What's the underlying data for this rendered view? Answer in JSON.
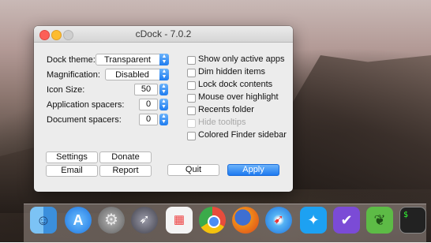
{
  "window": {
    "title": "cDock - 7.0.2"
  },
  "settings": {
    "dock_theme": {
      "label": "Dock theme:",
      "value": "Transparent"
    },
    "magnification": {
      "label": "Magnification:",
      "value": "Disabled"
    },
    "icon_size": {
      "label": "Icon Size:",
      "value": "50"
    },
    "app_spacers": {
      "label": "Application spacers:",
      "value": "0"
    },
    "doc_spacers": {
      "label": "Document spacers:",
      "value": "0"
    }
  },
  "options": [
    {
      "label": "Show only active apps",
      "checked": false,
      "disabled": false
    },
    {
      "label": "Dim hidden items",
      "checked": false,
      "disabled": false
    },
    {
      "label": "Lock dock contents",
      "checked": false,
      "disabled": false
    },
    {
      "label": "Mouse over highlight",
      "checked": false,
      "disabled": false
    },
    {
      "label": "Recents folder",
      "checked": false,
      "disabled": false
    },
    {
      "label": "Hide tooltips",
      "checked": false,
      "disabled": true
    },
    {
      "label": "Colored Finder sidebar",
      "checked": false,
      "disabled": false
    }
  ],
  "buttons": {
    "settings": "Settings",
    "donate": "Donate",
    "email": "Email",
    "report": "Report",
    "quit": "Quit",
    "apply": "Apply"
  },
  "dock": {
    "apps": [
      {
        "icon": "finder-icon",
        "color": "#4aa3e8"
      },
      {
        "icon": "app-store-icon",
        "color": "#2f8fe6"
      },
      {
        "icon": "system-preferences-icon",
        "color": "#8a8a8a"
      },
      {
        "icon": "launchpad-icon",
        "color": "#6c6c7a"
      },
      {
        "icon": "app-grid-icon",
        "color": "#f2f2f2"
      },
      {
        "icon": "chrome-icon",
        "color": "#e74c3c"
      },
      {
        "icon": "firefox-icon",
        "color": "#f07a1a"
      },
      {
        "icon": "safari-icon",
        "color": "#2a8fe8"
      },
      {
        "icon": "twitter-icon",
        "color": "#1da1f2"
      },
      {
        "icon": "omnifocus-icon",
        "color": "#7b4bd6"
      },
      {
        "icon": "evernote-icon",
        "color": "#5dbb46"
      },
      {
        "icon": "terminal-icon",
        "color": "#222222"
      }
    ],
    "terminal_prompt": "$"
  }
}
